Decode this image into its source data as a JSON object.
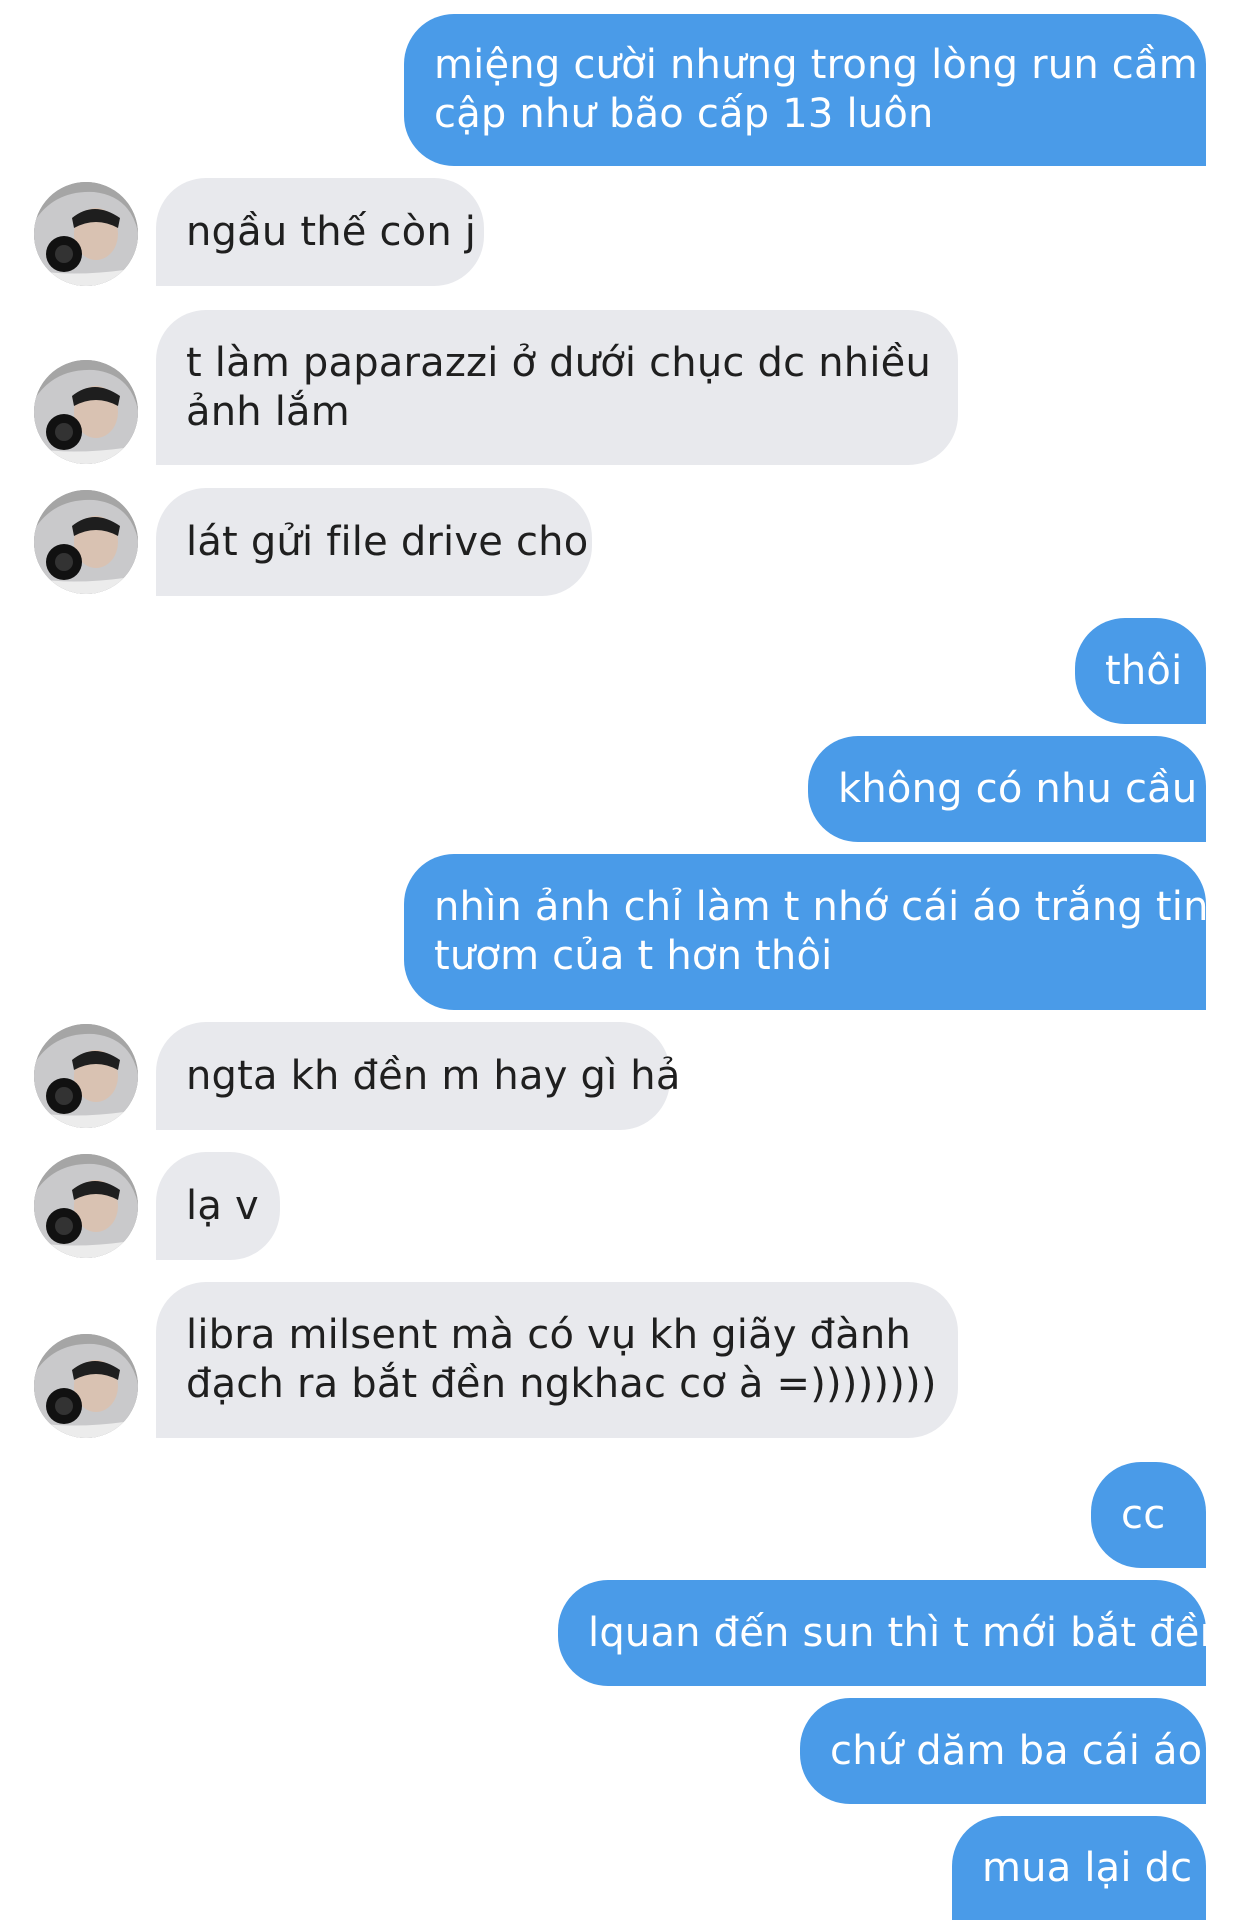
{
  "conversation": {
    "messages": [
      {
        "side": "sent",
        "lines": [
          "miệng cười nhưng trong lòng run cầm",
          "cập như bão cấp 13 luôn"
        ]
      },
      {
        "side": "received",
        "lines": [
          "ngầu thế còn j"
        ]
      },
      {
        "side": "received",
        "lines": [
          "t làm paparazzi ở dưới chục dc nhiều",
          "ảnh lắm"
        ]
      },
      {
        "side": "received",
        "lines": [
          "lát gửi file drive cho"
        ]
      },
      {
        "side": "sent",
        "lines": [
          "thôi"
        ]
      },
      {
        "side": "sent",
        "lines": [
          "không có nhu cầu"
        ]
      },
      {
        "side": "sent",
        "lines": [
          "nhìn ảnh chỉ làm t nhớ cái áo trắng tinh",
          "tươm của t hơn thôi"
        ]
      },
      {
        "side": "received",
        "lines": [
          "ngta kh đền m hay gì hả"
        ]
      },
      {
        "side": "received",
        "lines": [
          "lạ v"
        ]
      },
      {
        "side": "received",
        "lines": [
          "libra milsent mà có vụ kh giãy đành",
          "đạch ra bắt đền ngkhac cơ à =))))))))"
        ]
      },
      {
        "side": "sent",
        "lines": [
          "cc"
        ]
      },
      {
        "side": "sent",
        "lines": [
          "lquan đến sun thì t mới bắt đền"
        ]
      },
      {
        "side": "sent",
        "lines": [
          "chứ dăm ba cái áo"
        ]
      },
      {
        "side": "sent",
        "lines": [
          "mua lại dc"
        ]
      }
    ]
  },
  "colors": {
    "sent_bubble": "#4a9be8",
    "received_bubble": "#e8e9ed",
    "sent_text": "#ffffff",
    "received_text": "#1f1f1f"
  },
  "icons": {
    "avatar": "contact-avatar-photo"
  }
}
